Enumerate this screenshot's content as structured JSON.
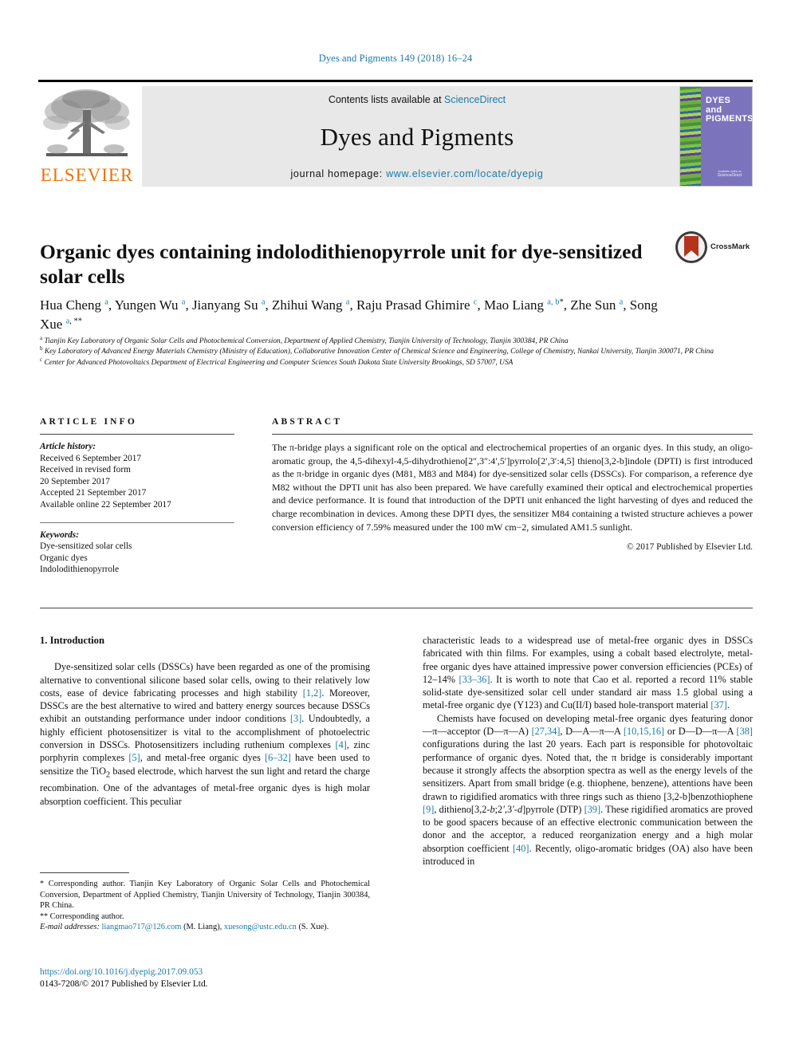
{
  "running_head": "Dyes and Pigments 149 (2018) 16–24",
  "header": {
    "contents_prefix": "Contents lists available at ",
    "sciencedirect": "ScienceDirect",
    "journal_name": "Dyes and Pigments",
    "homepage_prefix": "journal homepage: ",
    "homepage_url": "www.elsevier.com/locate/dyepig",
    "publisher": "ELSEVIER",
    "cover_title": "DYES\nand\nPIGMENTS",
    "cover_footer_small": "Available online at",
    "cover_footer_brand": "ScienceDirect",
    "link_color": "#1a7aa8",
    "elsevier_orange": "#E8740C",
    "cover_purple": "#7b74bd"
  },
  "article": {
    "title": "Organic dyes containing indolodithienopyrrole unit for dye-sensitized solar cells",
    "crossmark_label": "CrossMark",
    "authors": [
      {
        "name": "Hua Cheng",
        "marks": "a"
      },
      {
        "name": "Yungen Wu",
        "marks": "a"
      },
      {
        "name": "Jianyang Su",
        "marks": "a"
      },
      {
        "name": "Zhihui Wang",
        "marks": "a"
      },
      {
        "name": "Raju Prasad Ghimire",
        "marks": "c"
      },
      {
        "name": "Mao Liang",
        "marks": "a, b, *"
      },
      {
        "name": "Zhe Sun",
        "marks": "a"
      },
      {
        "name": "Song Xue",
        "marks": "a, **"
      }
    ],
    "affiliations": [
      {
        "label": "a",
        "text": "Tianjin Key Laboratory of Organic Solar Cells and Photochemical Conversion, Department of Applied Chemistry, Tianjin University of Technology, Tianjin 300384, PR China"
      },
      {
        "label": "b",
        "text": "Key Laboratory of Advanced Energy Materials Chemistry (Ministry of Education), Collaborative Innovation Center of Chemical Science and Engineering, College of Chemistry, Nankai University, Tianjin 300071, PR China"
      },
      {
        "label": "c",
        "text": "Center for Advanced Photovoltaics Department of Electrical Engineering and Computer Sciences South Dakota State University Brookings, SD 57007, USA"
      }
    ]
  },
  "article_info": {
    "heading": "ARTICLE INFO",
    "history_label": "Article history:",
    "history": [
      "Received 6 September 2017",
      "Received in revised form",
      "20 September 2017",
      "Accepted 21 September 2017",
      "Available online 22 September 2017"
    ],
    "keywords_label": "Keywords:",
    "keywords": [
      "Dye-sensitized solar cells",
      "Organic dyes",
      "Indolodithienopyrrole"
    ]
  },
  "abstract": {
    "heading": "ABSTRACT",
    "text": "The π-bridge plays a significant role on the optical and electrochemical properties of an organic dyes. In this study, an oligo-aromatic group, the 4,5-dihexyl-4,5-dihydrothieno[2″,3″:4′,5′]pyrrolo[2′,3′:4,5] thieno[3,2-b]indole (DPTI) is first introduced as the π-bridge in organic dyes (M81, M83 and M84) for dye-sensitized solar cells (DSSCs). For comparison, a reference dye M82 without the DPTI unit has also been prepared. We have carefully examined their optical and electrochemical properties and device performance. It is found that introduction of the DPTI unit enhanced the light harvesting of dyes and reduced the charge recombination in devices. Among these DPTI dyes, the sensitizer M84 containing a twisted structure achieves a power conversion efficiency of 7.59% measured under the 100 mW cm−2, simulated AM1.5 sunlight.",
    "copyright": "© 2017 Published by Elsevier Ltd."
  },
  "body": {
    "section_heading": "1. Introduction",
    "left_paragraphs": [
      "Dye-sensitized solar cells (DSSCs) have been regarded as one of the promising alternative to conventional silicone based solar cells, owing to their relatively low costs, ease of device fabricating processes and high stability [1,2]. Moreover, DSSCs are the best alternative to wired and battery energy sources because DSSCs exhibit an outstanding performance under indoor conditions [3]. Undoubtedly, a highly efficient photosensitizer is vital to the accomplishment of photoelectric conversion in DSSCs. Photosensitizers including ruthenium complexes [4], zinc porphyrin complexes [5], and metal-free organic dyes [6–32] have been used to sensitize the TiO2 based electrode, which harvest the sun light and retard the charge recombination. One of the advantages of metal-free organic dyes is high molar absorption coefficient. This peculiar"
    ],
    "right_paragraphs": [
      "characteristic leads to a widespread use of metal-free organic dyes in DSSCs fabricated with thin films. For examples, using a cobalt based electrolyte, metal-free organic dyes have attained impressive power conversion efficiencies (PCEs) of 12–14% [33–36]. It is worth to note that Cao et al. reported a record 11% stable solid-state dye-sensitized solar cell under standard air mass 1.5 global using a metal-free organic dye (Y123) and Cu(II/I) based hole-transport material [37].",
      "Chemists have focused on developing metal-free organic dyes featuring donor—π—acceptor (D—π—A) [27,34], D—A—π—A [10,15,16] or D—D—π—A [38] configurations during the last 20 years. Each part is responsible for photovoltaic performance of organic dyes. Noted that, the π bridge is considerably important because it strongly affects the absorption spectra as well as the energy levels of the sensitizers. Apart from small bridge (e.g. thiophene, benzene), attentions have been drawn to rigidified aromatics with three rings such as thieno [3,2-b]benzothiophene [9], dithieno[3,2-b;2′,3′-d]pyrrole (DTP) [39]. These rigidified aromatics are proved to be good spacers because of an effective electronic communication between the donor and the acceptor, a reduced reorganization energy and a high molar absorption coefficient [40]. Recently, oligo-aromatic bridges (OA) also have been introduced in"
    ]
  },
  "footnotes": {
    "corr1_mark": "*",
    "corr1": "Corresponding author. Tianjin Key Laboratory of Organic Solar Cells and Photochemical Conversion, Department of Applied Chemistry, Tianjin University of Technology, Tianjin 300384, PR China.",
    "corr2_mark": "**",
    "corr2": "Corresponding author.",
    "email_label": "E-mail addresses:",
    "email1": "liangmao717@126.com",
    "email1_owner": "(M. Liang),",
    "email2": "xuesong@ustc.edu.cn",
    "email2_owner": "(S. Xue)."
  },
  "footer": {
    "doi": "https://doi.org/10.1016/j.dyepig.2017.09.053",
    "issn_line": "0143-7208/© 2017 Published by Elsevier Ltd."
  }
}
